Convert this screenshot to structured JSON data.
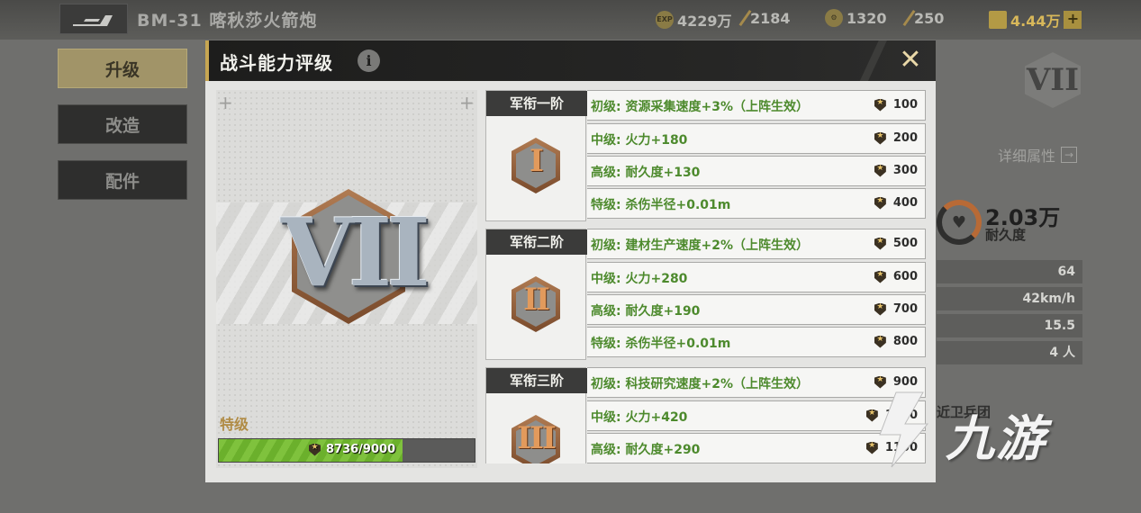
{
  "topbar": {
    "vehicle_title": "BM-31 喀秋莎火箭炮",
    "resources": [
      {
        "icon": "exp-icon",
        "icon_label": "EXP",
        "value": "4229万"
      },
      {
        "icon": "stick-icon",
        "value": "2184"
      },
      {
        "icon": "gear-icon",
        "value": "1320"
      },
      {
        "icon": "wrench-icon",
        "value": "250"
      },
      {
        "icon": "gold-icon",
        "value": "4.44万"
      }
    ],
    "plus_label": "+"
  },
  "sidebar": {
    "items": [
      {
        "label": "升级",
        "active": true
      },
      {
        "label": "改造",
        "active": false
      },
      {
        "label": "配件",
        "active": false
      }
    ]
  },
  "background_panel": {
    "rank_numeral": "VII",
    "detail_link": "详细属性",
    "detail_arrow": "→",
    "durability_value": "2.03万",
    "durability_label": "耐久度",
    "stats": [
      "64",
      "42km/h",
      "15.5",
      "4 人"
    ],
    "unit_label": "近卫兵团"
  },
  "modal": {
    "title": "战斗能力评级",
    "info_label": "i",
    "close_label": "✕",
    "emblem_numeral": "VII",
    "grade_label": "特级",
    "progress": {
      "current": 8736,
      "max": 9000,
      "text": "8736/9000"
    },
    "tiers": [
      {
        "name": "军衔一阶",
        "numeral": "I",
        "perks": [
          {
            "text": "初级: 资源采集速度+3%（上阵生效）",
            "cost": "100"
          },
          {
            "text": "中级: 火力+180",
            "cost": "200"
          },
          {
            "text": "高级: 耐久度+130",
            "cost": "300"
          },
          {
            "text": "特级: 杀伤半径+0.01m",
            "cost": "400"
          }
        ]
      },
      {
        "name": "军衔二阶",
        "numeral": "II",
        "perks": [
          {
            "text": "初级: 建材生产速度+2%（上阵生效）",
            "cost": "500"
          },
          {
            "text": "中级: 火力+280",
            "cost": "600"
          },
          {
            "text": "高级: 耐久度+190",
            "cost": "700"
          },
          {
            "text": "特级: 杀伤半径+0.01m",
            "cost": "800"
          }
        ]
      },
      {
        "name": "军衔三阶",
        "numeral": "III",
        "perks": [
          {
            "text": "初级: 科技研究速度+2%（上阵生效）",
            "cost": "900"
          },
          {
            "text": "中级: 火力+420",
            "cost": "1000"
          },
          {
            "text": "高级: 耐久度+290",
            "cost": "1100"
          }
        ]
      }
    ]
  },
  "watermark": {
    "text": "九游"
  },
  "colors": {
    "accent_gold": "#c7a652",
    "perk_green": "#4d8a2d",
    "progress_green": "#7fc23d",
    "tier_bronze": "#b07b52"
  }
}
